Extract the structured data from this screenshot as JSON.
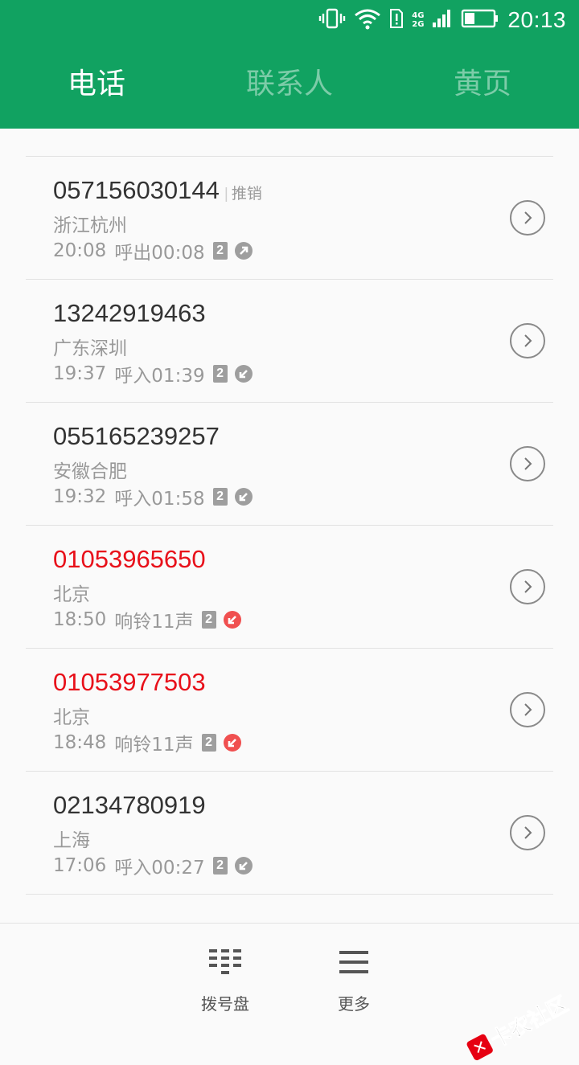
{
  "status_bar": {
    "network_top": "4G",
    "network_bottom": "2G",
    "time": "20:13"
  },
  "tabs": [
    {
      "label": "电话",
      "active": true
    },
    {
      "label": "联系人",
      "active": false
    },
    {
      "label": "黄页",
      "active": false
    }
  ],
  "calls": [
    {
      "number": "057156030144",
      "tag": "推销",
      "location": "浙江杭州",
      "time": "20:08",
      "status": "呼出00:08",
      "sim": "2",
      "direction": "outgoing",
      "missed": false
    },
    {
      "number": "13242919463",
      "tag": "",
      "location": "广东深圳",
      "time": "19:37",
      "status": "呼入01:39",
      "sim": "2",
      "direction": "incoming",
      "missed": false
    },
    {
      "number": "055165239257",
      "tag": "",
      "location": "安徽合肥",
      "time": "19:32",
      "status": "呼入01:58",
      "sim": "2",
      "direction": "incoming",
      "missed": false
    },
    {
      "number": "01053965650",
      "tag": "",
      "location": "北京",
      "time": "18:50",
      "status": "响铃11声",
      "sim": "2",
      "direction": "missed",
      "missed": true
    },
    {
      "number": "01053977503",
      "tag": "",
      "location": "北京",
      "time": "18:48",
      "status": "响铃11声",
      "sim": "2",
      "direction": "missed",
      "missed": true
    },
    {
      "number": "02134780919",
      "tag": "",
      "location": "上海",
      "time": "17:06",
      "status": "呼入00:27",
      "sim": "2",
      "direction": "incoming",
      "missed": false
    }
  ],
  "bottom_bar": {
    "dialpad_label": "拨号盘",
    "more_label": "更多"
  },
  "watermark": {
    "text": "卡农社区"
  },
  "colors": {
    "brand_green": "#11a261",
    "missed_red": "#e8101a",
    "secondary_text": "#999999"
  }
}
